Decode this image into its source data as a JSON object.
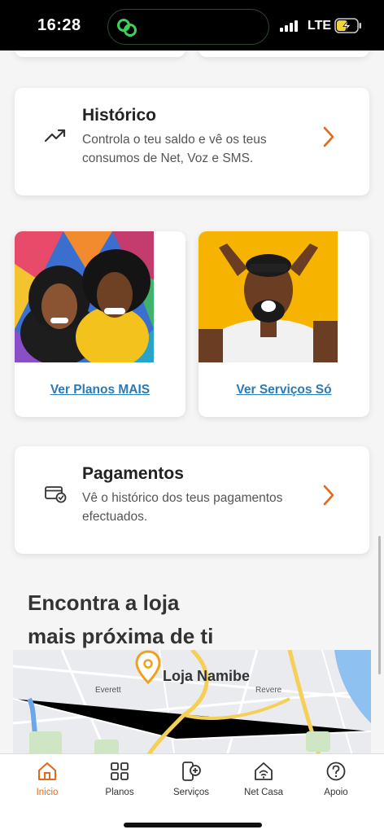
{
  "status_bar": {
    "time": "16:28",
    "network": "LTE"
  },
  "historico": {
    "title": "Histórico",
    "description": "Controla o teu saldo e vê os teus consumos de Net, Voz e SMS."
  },
  "promos": [
    {
      "link": "Ver Planos MAIS"
    },
    {
      "link": "Ver Serviços Só"
    }
  ],
  "pagamentos": {
    "title": "Pagamentos",
    "description": "Vê o histórico dos teus pagamentos efectuados."
  },
  "store_finder": {
    "heading_line1": "Encontra a loja",
    "heading_line2": "mais próxima de ti",
    "map": {
      "pin_label": "Loja Namibe",
      "place_1": "Everett",
      "place_2": "Revere"
    }
  },
  "bottom_nav": {
    "items": [
      {
        "label": "Inicio",
        "icon": "home-icon",
        "active": true
      },
      {
        "label": "Planos",
        "icon": "grid-icon",
        "active": false
      },
      {
        "label": "Serviços",
        "icon": "phone-plus-icon",
        "active": false
      },
      {
        "label": "Net Casa",
        "icon": "home-wifi-icon",
        "active": false
      },
      {
        "label": "Apoio",
        "icon": "help-icon",
        "active": false
      }
    ]
  },
  "colors": {
    "accent": "#e06a1a",
    "link": "#2a7ab8",
    "background": "#f5f5f5"
  }
}
